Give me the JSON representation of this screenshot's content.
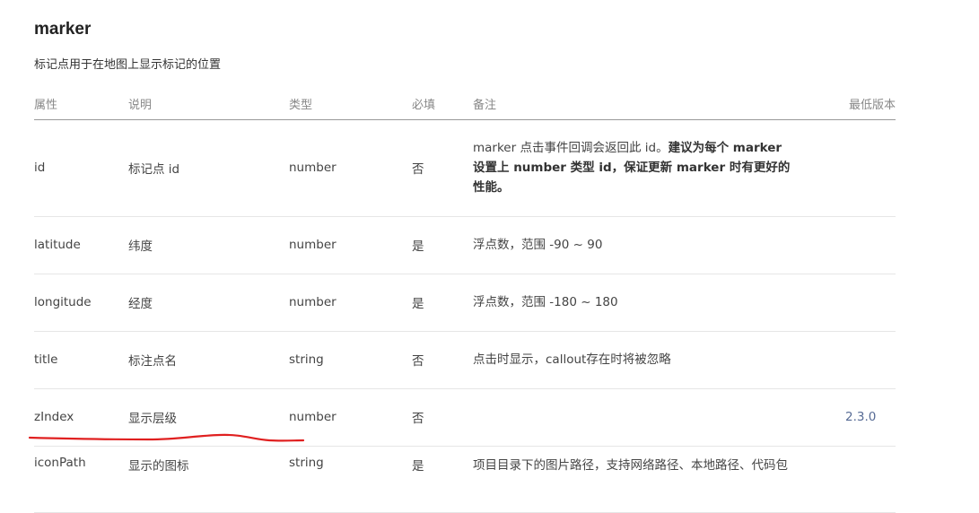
{
  "section": {
    "title": "marker",
    "description": "标记点用于在地图上显示标记的位置"
  },
  "table": {
    "headers": [
      "属性",
      "说明",
      "类型",
      "必填",
      "备注",
      "最低版本"
    ],
    "rows": [
      {
        "attr": "id",
        "desc": "标记点 id",
        "type": "number",
        "required": "否",
        "note_plain": "marker 点击事件回调会返回此 id。",
        "note_bold": "建议为每个 marker 设置上 number 类型 id，保证更新 marker 时有更好的性能。",
        "version": ""
      },
      {
        "attr": "latitude",
        "desc": "纬度",
        "type": "number",
        "required": "是",
        "note_plain": "浮点数，范围 -90 ~ 90",
        "note_bold": "",
        "version": ""
      },
      {
        "attr": "longitude",
        "desc": "经度",
        "type": "number",
        "required": "是",
        "note_plain": "浮点数，范围 -180 ~ 180",
        "note_bold": "",
        "version": ""
      },
      {
        "attr": "title",
        "desc": "标注点名",
        "type": "string",
        "required": "否",
        "note_plain": "点击时显示，callout存在时将被忽略",
        "note_bold": "",
        "version": ""
      },
      {
        "attr": "zIndex",
        "desc": "显示层级",
        "type": "number",
        "required": "否",
        "note_plain": "",
        "note_bold": "",
        "version": "2.3.0"
      },
      {
        "attr": "iconPath",
        "desc": "显示的图标",
        "type": "string",
        "required": "是",
        "note_plain": "项目目录下的图片路径，支持网络路径、本地路径、代码包",
        "note_bold": "",
        "version": ""
      }
    ]
  },
  "annotation": {
    "color": "#e02020",
    "target_row": "zIndex"
  },
  "colors": {
    "link": "#576b95",
    "header_text": "#888888",
    "header_rule": "#999999",
    "row_rule": "#e6e6e6"
  }
}
